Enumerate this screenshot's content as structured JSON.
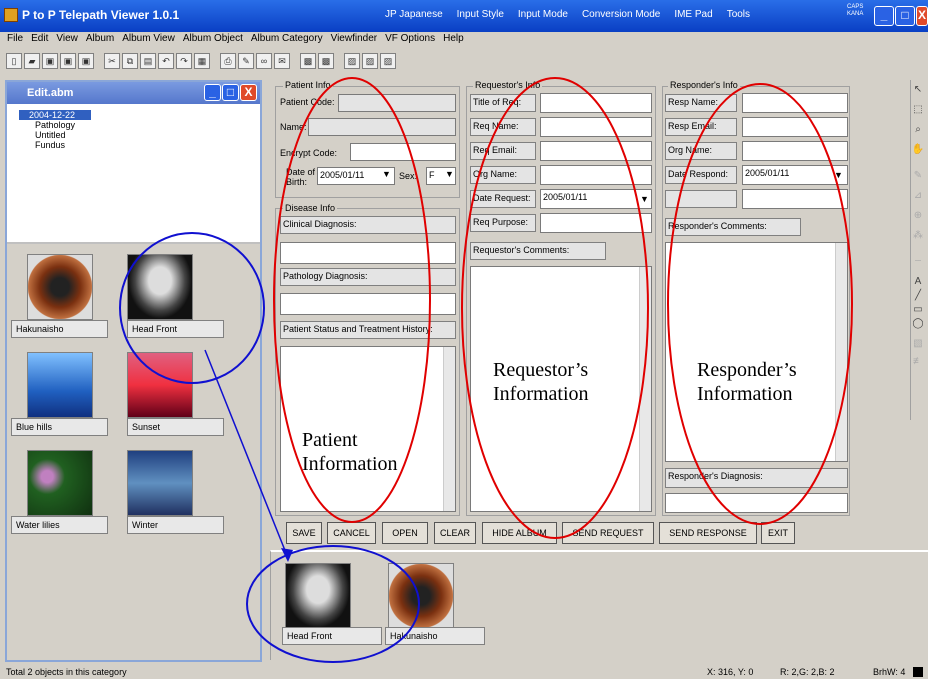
{
  "window": {
    "title": "P to P Telepath Viewer 1.0.1",
    "min": "_",
    "max": "□",
    "close": "X"
  },
  "ime": {
    "items": [
      "JP Japanese",
      "Input Style",
      "Input Mode",
      "Conversion Mode",
      "IME Pad",
      "Tools"
    ],
    "caps": "CAPS",
    "kana": "KANA"
  },
  "menu": [
    "File",
    "Edit",
    "View",
    "Album",
    "Album View",
    "Album Object",
    "Album Category",
    "Viewfinder",
    "VF Options",
    "Help"
  ],
  "album": {
    "title": "Edit.abm",
    "tree": [
      "2004-12-22",
      "Pathology",
      "Untitled",
      "Fundus"
    ],
    "thumbs": [
      "Hakunaisho",
      "Head Front",
      "Blue hills",
      "Sunset",
      "Water lilies",
      "Winter"
    ]
  },
  "patient": {
    "group": "Patient Info",
    "code": "Patient Code:",
    "name": "Name:",
    "encrypt": "Encrypt Code:",
    "dob_label": "Date of Birth:",
    "dob": "2005/01/11",
    "sex_label": "Sex:",
    "sex": "F"
  },
  "disease": {
    "group": "Disease Info",
    "clinical": "Clinical Diagnosis:",
    "pathology": "Pathology Diagnosis:",
    "history": "Patient Status and Treatment History:"
  },
  "requestor": {
    "group": "Requestor's Info",
    "title": "Title of Req:",
    "name": "Req Name:",
    "email": "Req Email:",
    "org": "Org Name:",
    "date_label": "Date Request:",
    "date": "2005/01/11",
    "purpose": "Req Purpose:",
    "comments": "Requestor's Comments:"
  },
  "responder": {
    "group": "Responder's Info",
    "name": "Resp Name:",
    "email": "Resp Email:",
    "org": "Org Name:",
    "date_label": "Date Respond:",
    "date": "2005/01/11",
    "comments": "Responder's Comments:",
    "diagnosis": "Responder's Diagnosis:"
  },
  "annotations": {
    "patient_line1": "Patient",
    "patient_line2": "Information",
    "req_line1": "Requestor’s",
    "req_line2": "Information",
    "resp_line1": "Responder’s",
    "resp_line2": "Information"
  },
  "buttons": {
    "save": "SAVE",
    "cancel": "CANCEL",
    "open": "OPEN",
    "clear": "CLEAR",
    "hide": "HIDE ALBUM",
    "send_request": "SEND REQUEST",
    "send_response": "SEND RESPONSE",
    "exit": "EXIT"
  },
  "tray": [
    "Head Front",
    "Hakunaisho"
  ],
  "status": {
    "left": "Total 2 objects in this category",
    "coords": "X: 316, Y:  0",
    "rgb": "R: 2,G: 2,B: 2",
    "brush": "BrhW: 4"
  }
}
